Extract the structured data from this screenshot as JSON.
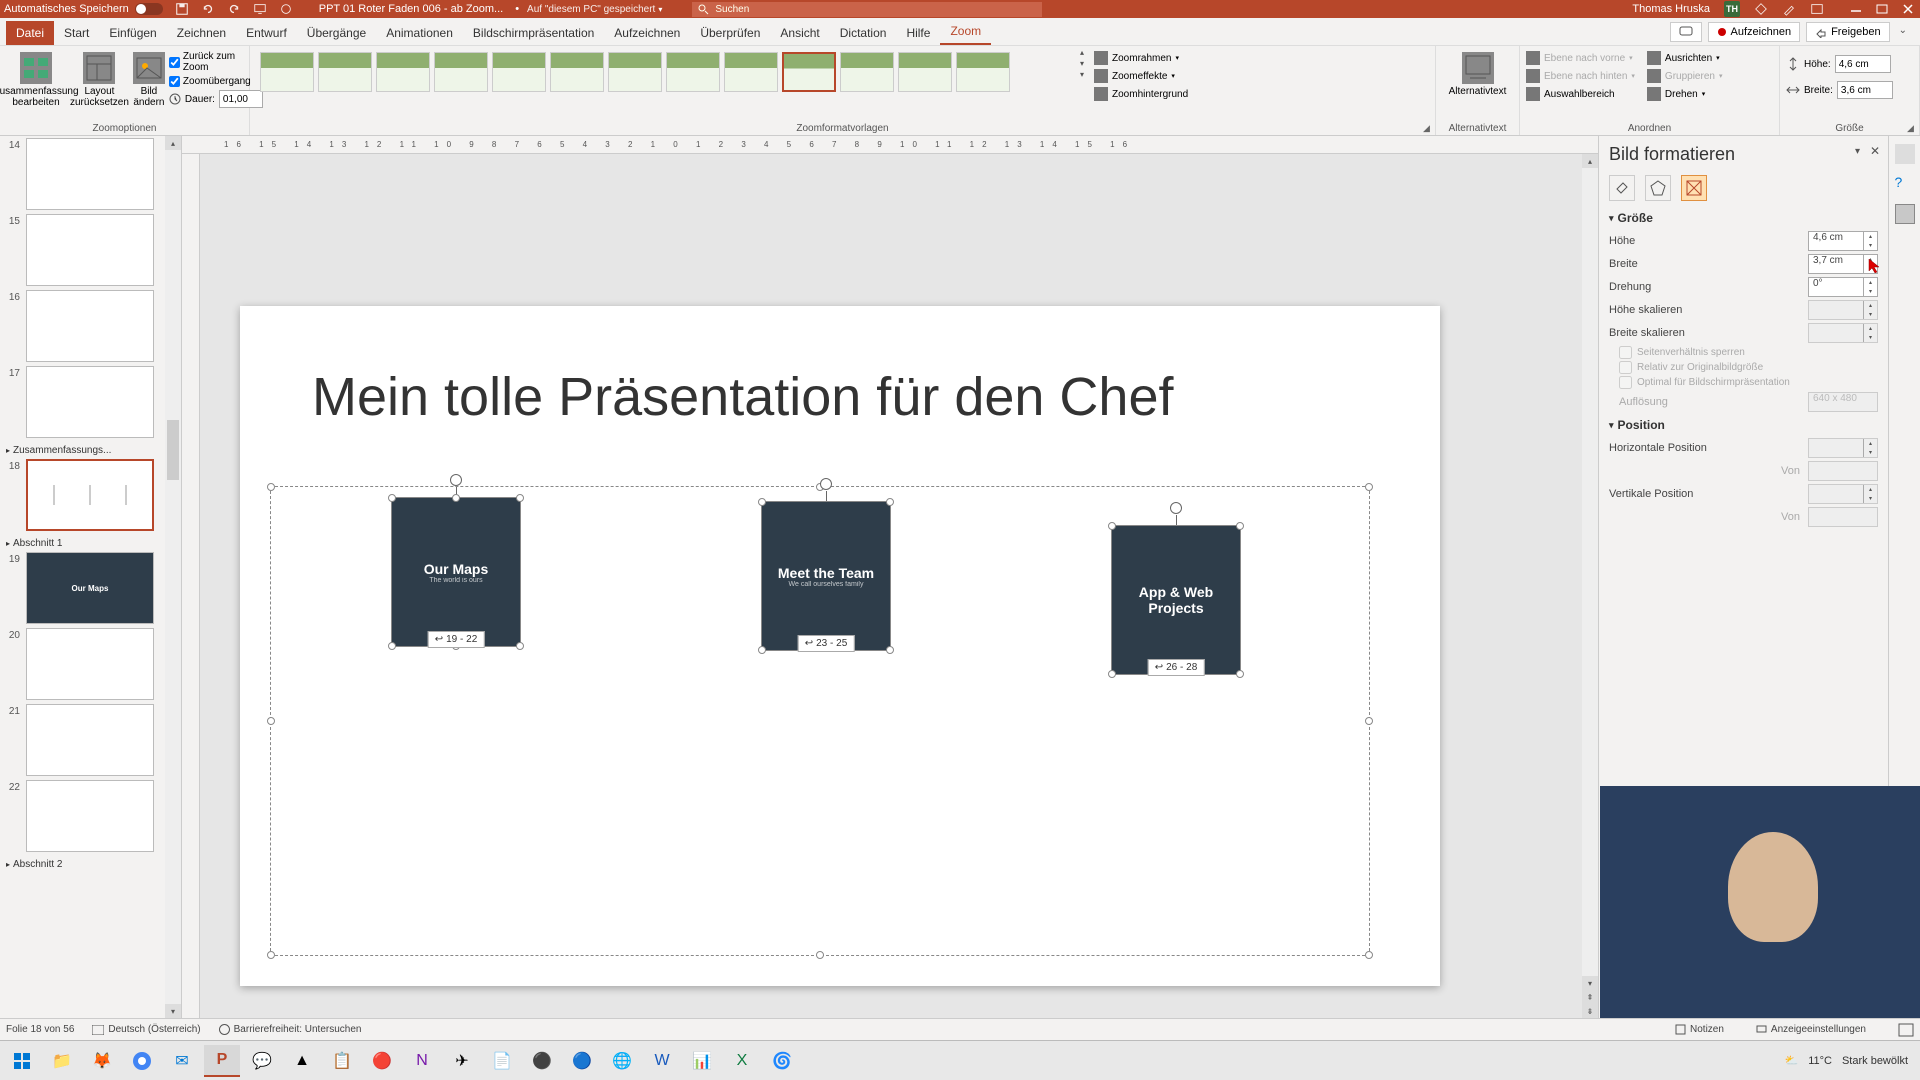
{
  "titlebar": {
    "autosave": "Automatisches Speichern",
    "filename": "PPT 01 Roter Faden 006 - ab Zoom...",
    "save_location": "Auf \"diesem PC\" gespeichert",
    "search_placeholder": "Suchen",
    "user_name": "Thomas Hruska",
    "user_initials": "TH"
  },
  "menu": {
    "tabs": [
      "Datei",
      "Start",
      "Einfügen",
      "Zeichnen",
      "Entwurf",
      "Übergänge",
      "Animationen",
      "Bildschirmpräsentation",
      "Aufzeichnen",
      "Überprüfen",
      "Ansicht",
      "Dictation",
      "Hilfe",
      "Zoom"
    ],
    "active_index": 13,
    "right": {
      "comments": "",
      "record": "Aufzeichnen",
      "share": "Freigeben"
    }
  },
  "ribbon": {
    "groups": {
      "zoomoptions": {
        "label": "Zoomoptionen",
        "summary_edit": "Zusammenfassung bearbeiten",
        "layout_reset": "Layout zurücksetzen",
        "change_image": "Bild ändern",
        "return_zoom": "Zurück zum Zoom",
        "zoom_transition": "Zoomübergang",
        "duration_label": "Dauer:",
        "duration_value": "01,00"
      },
      "zoomstyles": {
        "label": "Zoomformatvorlagen"
      },
      "effects": {
        "zoom_frame": "Zoomrahmen",
        "zoom_effects": "Zoomeffekte",
        "zoom_background": "Zoomhintergrund"
      },
      "alttext": {
        "label": "Alternativtext",
        "btn": "Alternativtext"
      },
      "arrange": {
        "label": "Anordnen",
        "front": "Ebene nach vorne",
        "back": "Ebene nach hinten",
        "selection": "Auswahlbereich",
        "align": "Ausrichten",
        "group": "Gruppieren",
        "rotate": "Drehen"
      },
      "size": {
        "label": "Größe",
        "height_label": "Höhe:",
        "height_value": "4,6 cm",
        "width_label": "Breite:",
        "width_value": "3,6 cm"
      }
    }
  },
  "thumbs": {
    "items": [
      {
        "num": "14"
      },
      {
        "num": "15"
      },
      {
        "num": "16"
      },
      {
        "num": "17"
      }
    ],
    "summary_section": "Zusammenfassungs...",
    "selected": {
      "num": "18"
    },
    "section1": "Abschnitt 1",
    "items2": [
      {
        "num": "19",
        "dark": true,
        "text": "Our Maps"
      },
      {
        "num": "20"
      },
      {
        "num": "21"
      },
      {
        "num": "22"
      }
    ],
    "section2": "Abschnitt 2"
  },
  "slide": {
    "title": "Mein tolle Präsentation für den Chef",
    "cards": [
      {
        "title": "Our Maps",
        "sub": "The world is ours",
        "range": "19 - 22"
      },
      {
        "title": "Meet the Team",
        "sub": "We call ourselves family",
        "range": "23 - 25"
      },
      {
        "title": "App & Web Projects",
        "sub": "",
        "range": "26 - 28"
      }
    ]
  },
  "formatpane": {
    "title": "Bild formatieren",
    "size_section": "Größe",
    "height_label": "Höhe",
    "height_value": "4,6 cm",
    "width_label": "Breite",
    "width_value": "3,7 cm",
    "rotation_label": "Drehung",
    "rotation_value": "0°",
    "scale_h_label": "Höhe skalieren",
    "scale_w_label": "Breite skalieren",
    "lock_aspect": "Seitenverhältnis sperren",
    "relative_orig": "Relativ zur Originalbildgröße",
    "optimal": "Optimal für Bildschirmpräsentation",
    "resolution_label": "Auflösung",
    "resolution_value": "640 x 480",
    "position_section": "Position",
    "hpos_label": "Horizontale Position",
    "from_label": "Von",
    "vpos_label": "Vertikale Position"
  },
  "statusbar": {
    "slide_info": "Folie 18 von 56",
    "language": "Deutsch (Österreich)",
    "accessibility": "Barrierefreiheit: Untersuchen",
    "notes": "Notizen",
    "display": "Anzeigeeinstellungen"
  },
  "taskbar": {
    "weather_temp": "11°C",
    "weather_text": "Stark bewölkt"
  },
  "ruler": "16  15  14  13  12  11  10  9  8  7  6  5  4  3  2  1  0  1  2  3  4  5  6  7  8  9  10  11  12  13  14  15  16"
}
